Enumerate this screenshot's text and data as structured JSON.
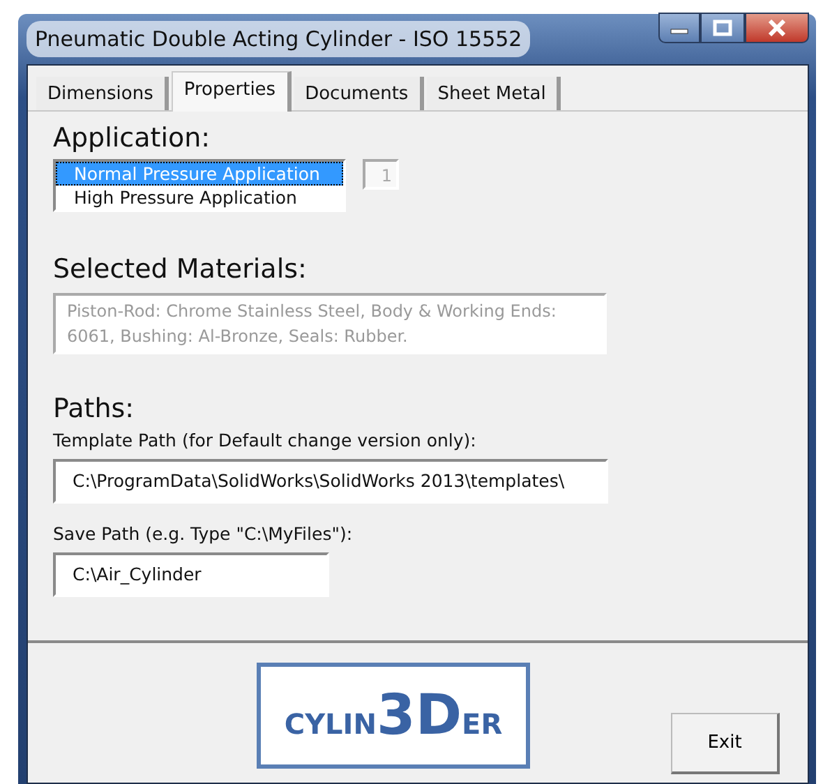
{
  "window": {
    "title": "Pneumatic Double Acting Cylinder - ISO 15552"
  },
  "tabs": [
    {
      "label": "Dimensions",
      "selected": false
    },
    {
      "label": "Properties",
      "selected": true
    },
    {
      "label": "Documents",
      "selected": false
    },
    {
      "label": "Sheet Metal",
      "selected": false
    }
  ],
  "application": {
    "heading": "Application:",
    "options": [
      {
        "label": "Normal Pressure Application",
        "selected": true
      },
      {
        "label": "High Pressure Application",
        "selected": false
      }
    ],
    "counter": "1"
  },
  "materials": {
    "heading": "Selected Materials:",
    "value": "Piston-Rod: Chrome Stainless Steel, Body & Working Ends: 6061, Bushing: Al-Bronze, Seals: Rubber."
  },
  "paths": {
    "heading": "Paths:",
    "template_label": "Template Path (for Default change version only):",
    "template_value": "C:\\ProgramData\\SolidWorks\\SolidWorks 2013\\templates\\",
    "save_label": "Save Path (e.g. Type \"C:\\MyFiles\"):",
    "save_value": "C:\\Air_Cylinder"
  },
  "logo": {
    "parts": [
      "CYLIN",
      "3D",
      "ER"
    ]
  },
  "buttons": [
    "Exit"
  ]
}
